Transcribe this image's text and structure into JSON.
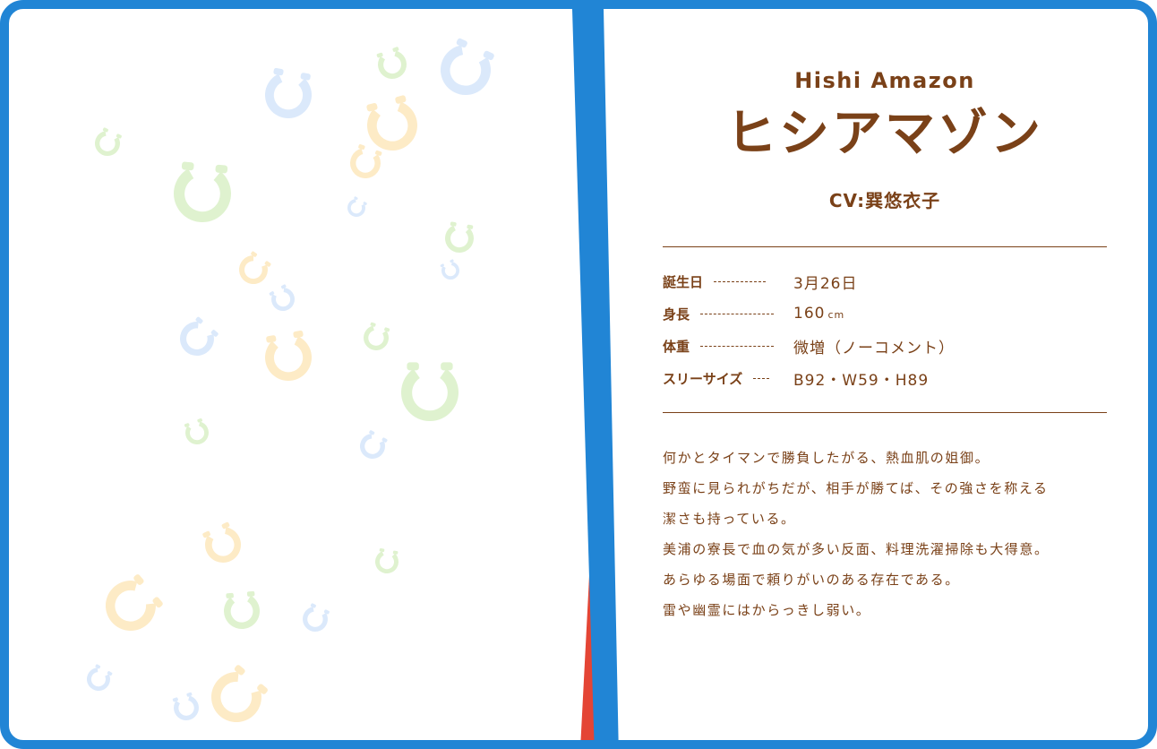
{
  "character": {
    "name_en": "Hishi Amazon",
    "name_jp": "ヒシアマゾン",
    "cv": "CV:巽悠衣子"
  },
  "profile": [
    {
      "label": "誕生日",
      "value": "3月26日"
    },
    {
      "label": "身長",
      "value": "160",
      "unit": "cm"
    },
    {
      "label": "体重",
      "value": "微増（ノーコメント）"
    },
    {
      "label": "スリーサイズ",
      "value": "B92・W59・H89"
    }
  ],
  "description": [
    "何かとタイマンで勝負したがる、熱血肌の姐御。",
    "野蛮に見られがちだが、相手が勝てば、その強さを称える",
    "潔さも持っている。",
    "美浦の寮長で血の気が多い反面、料理洗濯掃除も大得意。",
    "あらゆる場面で頼りがいのある存在である。",
    "雷や幽霊にはからっきし弱い。"
  ],
  "icons": {
    "decoration": "horseshoe-icon"
  },
  "colors": {
    "frame": "#2185d5",
    "accent_red": "#e44535",
    "text": "#7a4118",
    "horseshoe_blue": "#dbe9fb",
    "horseshoe_green": "#dff2cf",
    "horseshoe_yellow": "#fdebc6"
  }
}
